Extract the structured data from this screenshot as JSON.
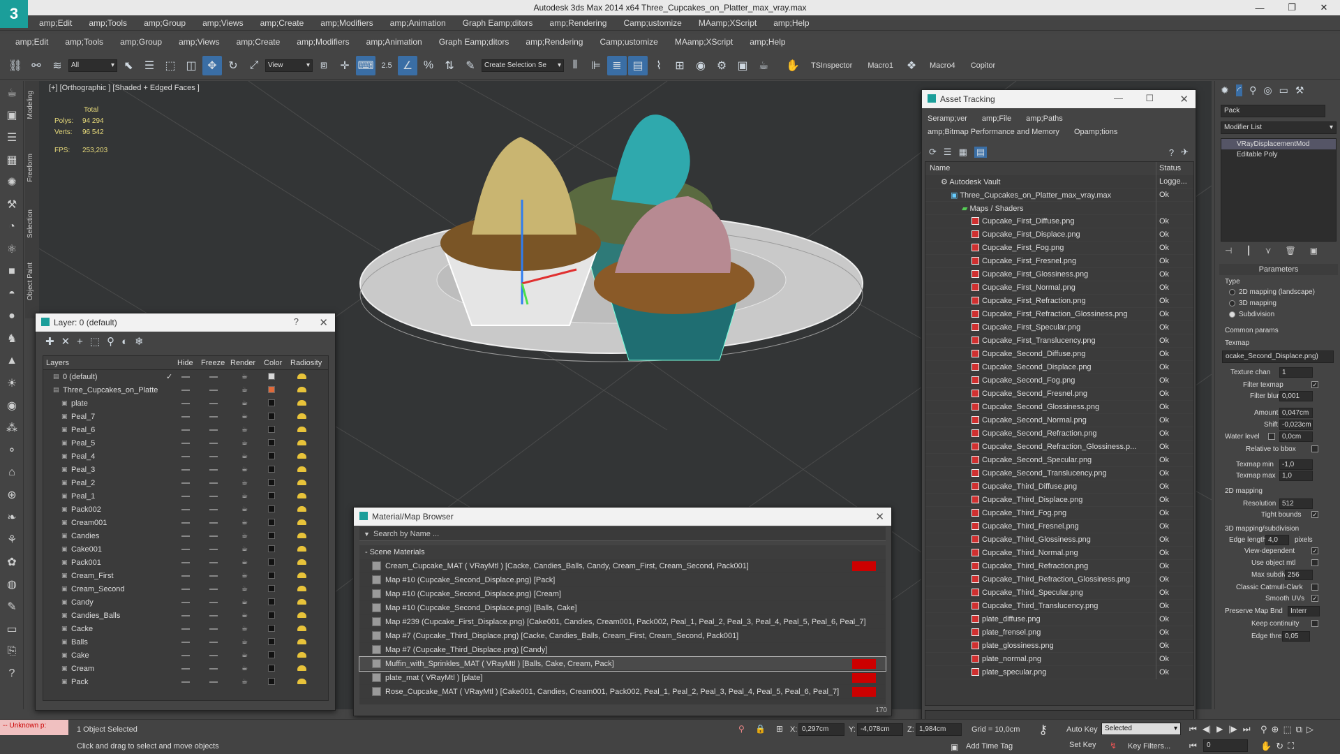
{
  "app": {
    "title": "Autodesk 3ds Max  2014 x64     Three_Cupcakes_on_Platter_max_vray.max",
    "logo": "3"
  },
  "menu1": [
    "amp;Edit",
    "amp;Tools",
    "amp;Group",
    "amp;Views",
    "amp;Create",
    "amp;Modifiers",
    "amp;Animation",
    "Graph Eamp;ditors",
    "amp;Rendering",
    "Camp;ustomize",
    "MAamp;XScript",
    "amp;Help"
  ],
  "menu2": [
    "amp;Edit",
    "amp;Tools",
    "amp;Group",
    "amp;Views",
    "amp;Create",
    "amp;Modifiers",
    "amp;Animation",
    "Graph Eamp;ditors",
    "amp;Rendering",
    "Camp;ustomize",
    "MAamp;XScript",
    "amp;Help"
  ],
  "toolbar": {
    "filter_select": "All",
    "view_select": "View",
    "snap_label": "2.5",
    "selection_set": "Create Selection Se",
    "ts_inspector": "TSInspector",
    "macro1": "Macro1",
    "macro4": "Macro4",
    "copitor": "Copitor"
  },
  "vtabs": [
    "Modeling",
    "Freeform",
    "Selection",
    "Object Paint"
  ],
  "viewport": {
    "label": "[+] [Orthographic ] [Shaded + Edged Faces ]",
    "stats": {
      "total_label": "Total",
      "polys_label": "Polys:",
      "polys": "94 294",
      "verts_label": "Verts:",
      "verts": "96 542",
      "fps_label": "FPS:",
      "fps": "253,203"
    }
  },
  "layer_window": {
    "title": "Layer: 0 (default)",
    "help": "?",
    "columns": [
      "Layers",
      "Hide",
      "Freeze",
      "Render",
      "Color",
      "Radiosity"
    ],
    "rows": [
      {
        "name": "0 (default)",
        "type": "layer",
        "color": "#d8d8d8"
      },
      {
        "name": "Three_Cupcakes_on_Platte",
        "type": "layer",
        "color": "#e06a3a"
      },
      {
        "name": "plate",
        "type": "obj"
      },
      {
        "name": "Peal_7",
        "type": "obj"
      },
      {
        "name": "Peal_6",
        "type": "obj"
      },
      {
        "name": "Peal_5",
        "type": "obj"
      },
      {
        "name": "Peal_4",
        "type": "obj"
      },
      {
        "name": "Peal_3",
        "type": "obj"
      },
      {
        "name": "Peal_2",
        "type": "obj"
      },
      {
        "name": "Peal_1",
        "type": "obj"
      },
      {
        "name": "Pack002",
        "type": "obj"
      },
      {
        "name": "Cream001",
        "type": "obj"
      },
      {
        "name": "Candies",
        "type": "obj"
      },
      {
        "name": "Cake001",
        "type": "obj"
      },
      {
        "name": "Pack001",
        "type": "obj"
      },
      {
        "name": "Cream_First",
        "type": "obj"
      },
      {
        "name": "Cream_Second",
        "type": "obj"
      },
      {
        "name": "Candy",
        "type": "obj"
      },
      {
        "name": "Candies_Balls",
        "type": "obj"
      },
      {
        "name": "Cacke",
        "type": "obj"
      },
      {
        "name": "Balls",
        "type": "obj"
      },
      {
        "name": "Cake",
        "type": "obj"
      },
      {
        "name": "Cream",
        "type": "obj"
      },
      {
        "name": "Pack",
        "type": "obj"
      }
    ]
  },
  "asset_window": {
    "title": "Asset Tracking",
    "menu": [
      "Seramp;ver",
      "amp;File",
      "amp;Paths",
      "amp;Bitmap Performance and Memory",
      "Opamp;tions"
    ],
    "columns": [
      "Name",
      "Status"
    ],
    "root": {
      "name": "Autodesk Vault",
      "status": "Logge..."
    },
    "file": {
      "name": "Three_Cupcakes_on_Platter_max_vray.max",
      "status": "Ok"
    },
    "folder": {
      "name": "Maps / Shaders",
      "status": ""
    },
    "maps": [
      "Cupcake_First_Diffuse.png",
      "Cupcake_First_Displace.png",
      "Cupcake_First_Fog.png",
      "Cupcake_First_Fresnel.png",
      "Cupcake_First_Glossiness.png",
      "Cupcake_First_Normal.png",
      "Cupcake_First_Refraction.png",
      "Cupcake_First_Refraction_Glossiness.png",
      "Cupcake_First_Specular.png",
      "Cupcake_First_Translucency.png",
      "Cupcake_Second_Diffuse.png",
      "Cupcake_Second_Displace.png",
      "Cupcake_Second_Fog.png",
      "Cupcake_Second_Fresnel.png",
      "Cupcake_Second_Glossiness.png",
      "Cupcake_Second_Normal.png",
      "Cupcake_Second_Refraction.png",
      "Cupcake_Second_Refraction_Glossiness.p...",
      "Cupcake_Second_Specular.png",
      "Cupcake_Second_Translucency.png",
      "Cupcake_Third_Diffuse.png",
      "Cupcake_Third_Displace.png",
      "Cupcake_Third_Fog.png",
      "Cupcake_Third_Fresnel.png",
      "Cupcake_Third_Glossiness.png",
      "Cupcake_Third_Normal.png",
      "Cupcake_Third_Refraction.png",
      "Cupcake_Third_Refraction_Glossiness.png",
      "Cupcake_Third_Specular.png",
      "Cupcake_Third_Translucency.png",
      "plate_diffuse.png",
      "plate_frensel.png",
      "plate_glossiness.png",
      "plate_normal.png",
      "plate_specular.png"
    ],
    "map_status": "Ok"
  },
  "material_browser": {
    "title": "Material/Map Browser",
    "search_placeholder": "Search by Name ...",
    "group": "- Scene Materials",
    "rows": [
      {
        "text": "Cream_Cupcake_MAT  ( VRayMtl )  [Cacke, Candies_Balls, Candy, Cream_First, Cream_Second, Pack001]",
        "red": true,
        "sel": false
      },
      {
        "text": "Map #10 (Cupcake_Second_Displace.png)  [Pack]",
        "red": false,
        "sel": false
      },
      {
        "text": "Map #10 (Cupcake_Second_Displace.png)  [Cream]",
        "red": false,
        "sel": false
      },
      {
        "text": "Map #10 (Cupcake_Second_Displace.png)  [Balls, Cake]",
        "red": false,
        "sel": false
      },
      {
        "text": "Map #239 (Cupcake_First_Displace.png)  [Cake001, Candies, Cream001, Pack002, Peal_1, Peal_2, Peal_3, Peal_4, Peal_5, Peal_6, Peal_7]",
        "red": false,
        "sel": false
      },
      {
        "text": "Map #7 (Cupcake_Third_Displace.png)  [Cacke, Candies_Balls, Cream_First, Cream_Second, Pack001]",
        "red": false,
        "sel": false
      },
      {
        "text": "Map #7 (Cupcake_Third_Displace.png)  [Candy]",
        "red": false,
        "sel": false
      },
      {
        "text": "Muffin_with_Sprinkles_MAT  ( VRayMtl )  [Balls, Cake, Cream, Pack]",
        "red": true,
        "sel": true
      },
      {
        "text": "plate_mat  ( VRayMtl )  [plate]",
        "red": true,
        "sel": false
      },
      {
        "text": "Rose_Cupcake_MAT  ( VRayMtl )  [Cake001, Candies, Cream001, Pack002, Peal_1, Peal_2, Peal_3, Peal_4, Peal_5, Peal_6, Peal_7]",
        "red": true,
        "sel": false
      }
    ]
  },
  "command_panel": {
    "object_name": "Pack",
    "modifier_list": "Modifier List",
    "stack": [
      "VRayDisplacementMod",
      "Editable Poly"
    ],
    "parameters_title": "Parameters",
    "type_label": "Type",
    "type_options": [
      "2D mapping (landscape)",
      "3D mapping",
      "Subdivision"
    ],
    "type_selected": 2,
    "common_label": "Common params",
    "texmap_label": "Texmap",
    "texmap_value": "ocake_Second_Displace.png)",
    "texture_chan_label": "Texture chan",
    "texture_chan": "1",
    "filter_texmap_label": "Filter texmap",
    "filter_blur_label": "Filter blur",
    "filter_blur": "0,001",
    "amount_label": "Amount",
    "amount": "0,047cm",
    "shift_label": "Shift",
    "shift": "-0,023cm",
    "water_label": "Water level",
    "water": "0,0cm",
    "relative_label": "Relative to bbox",
    "texmap_min_label": "Texmap min",
    "texmap_min": "-1,0",
    "texmap_max_label": "Texmap max",
    "texmap_max": "1,0",
    "mapping2d_label": "2D mapping",
    "resolution_label": "Resolution",
    "resolution": "512",
    "tight_label": "Tight bounds",
    "mapping3d_label": "3D mapping/subdivision",
    "edge_length_label": "Edge length",
    "edge_length": "4,0",
    "pixels_label": "pixels",
    "view_dep_label": "View-dependent",
    "use_obj_label": "Use object mtl",
    "max_subdivs_label": "Max subdivs",
    "max_subdivs": "256",
    "catmull_label": "Classic Catmull-Clark",
    "smooth_label": "Smooth UVs",
    "preserve_label": "Preserve Map Bnd",
    "preserve_value": "Interr",
    "keep_label": "Keep continuity",
    "edge_thresh_label": "Edge thresh",
    "edge_thresh": "0,05"
  },
  "status": {
    "unknown": "-- Unknown p:",
    "selected": "1 Object Selected",
    "hint": "Click and drag to select and move objects",
    "x_label": "X:",
    "x": "0,297cm",
    "y_label": "Y:",
    "y": "-4,078cm",
    "z_label": "Z:",
    "z": "1,984cm",
    "grid": "Grid = 10,0cm",
    "auto_key": "Auto Key",
    "set_key": "Set Key",
    "selected_drop": "Selected",
    "key_filters": "Key Filters...",
    "add_time_tag": "Add Time Tag",
    "frame": "0",
    "timeline_end": "170"
  },
  "colors": {
    "accent": "#3a6ea5",
    "titlebar": "#e9e9e9",
    "panel": "#444444",
    "viewport": "#333536",
    "warning": "#cc0000"
  }
}
